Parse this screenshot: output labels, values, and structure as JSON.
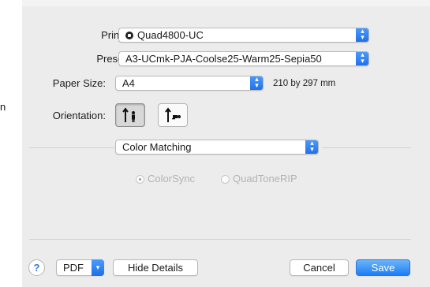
{
  "window_edge_text": "n",
  "printer": {
    "label": "Printer:",
    "value": "Quad4800-UC"
  },
  "presets": {
    "label": "Presets:",
    "value": "A3-UCmk-PJA-Coolse25-Warm25-Sepia50"
  },
  "paper_size": {
    "label": "Paper Size:",
    "value": "A4",
    "dimensions": "210 by 297 mm"
  },
  "orientation": {
    "label": "Orientation:",
    "selected": "portrait"
  },
  "section_popup": {
    "value": "Color Matching"
  },
  "color_matching": {
    "options": [
      {
        "label": "ColorSync",
        "selected": true,
        "enabled": false
      },
      {
        "label": "QuadToneRIP",
        "selected": false,
        "enabled": false
      }
    ]
  },
  "footer": {
    "help": "?",
    "pdf": "PDF",
    "hide_details": "Hide Details",
    "cancel": "Cancel",
    "save": "Save"
  },
  "colors": {
    "accent": "#1f6fe6",
    "sheet_bg": "#ececec"
  }
}
